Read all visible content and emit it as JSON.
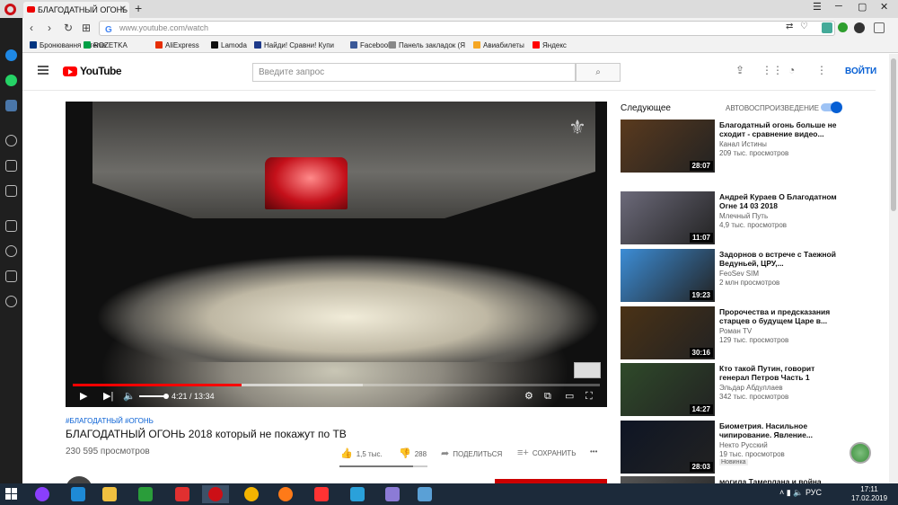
{
  "browser": {
    "tab_title": "БЛАГОДАТНЫЙ ОГОНЬ 2(",
    "url": "www.youtube.com/watch",
    "bookmarks": [
      {
        "label": "Бронювання готелів",
        "color": "#003580"
      },
      {
        "label": "ROZETKA",
        "color": "#00a046"
      },
      {
        "label": "AliExpress",
        "color": "#e62e04"
      },
      {
        "label": "Lamoda",
        "color": "#111111"
      },
      {
        "label": "Найди! Сравни! Купи",
        "color": "#1e3a8a"
      },
      {
        "label": "Facebook",
        "color": "#3b5998"
      },
      {
        "label": "Панель закладок (Я",
        "color": "#888888"
      },
      {
        "label": "Авиабилеты",
        "color": "#f5a623"
      },
      {
        "label": "Яндекс",
        "color": "#ff0000"
      }
    ]
  },
  "youtube": {
    "brand": "YouTube",
    "search_placeholder": "Введите запрос",
    "login_label": "ВОЙТИ"
  },
  "player": {
    "current_time": "4:21",
    "duration": "13:34",
    "time_sep": " / ",
    "played_fraction": 0.321,
    "buffered_fraction": 0.55,
    "volume_fraction": 1.0
  },
  "video": {
    "tags": "#БЛАГОДАТНЫЙ #ОГОНЬ",
    "title": "БЛАГОДАТНЫЙ ОГОНЬ 2018 который не покажут по ТВ",
    "views": "230 595 просмотров",
    "likes": "1,5 тыс.",
    "dislikes": "288",
    "share_label": "ПОДЕЛИТЬСЯ",
    "save_label": "СОХРАНИТЬ",
    "like_ratio": 0.84
  },
  "related": {
    "next_label": "Следующее",
    "autoplay_label": "АВТОВОСПРОИЗВЕДЕНИЕ",
    "items": [
      {
        "title": "Благодатный огонь больше не сходит - сравнение видео...",
        "channel": "Канал Истины",
        "views": "209 тыс. просмотров",
        "duration": "28:07",
        "color": "#5a3a1e"
      },
      {
        "title": "Андрей Кураев О Благодатном Огне 14 03 2018",
        "channel": "Млечный Путь",
        "views": "4,9 тыс. просмотров",
        "duration": "11:07",
        "color": "#6c6a7a"
      },
      {
        "title": "Задорнов о встрече с Таежной Ведуньей, ЦРУ,...",
        "channel": "FeoSev SIM",
        "views": "2 млн просмотров",
        "duration": "19:23",
        "color": "#3c8dd6"
      },
      {
        "title": "Пророчества и предсказания старцев о будущем Царе в...",
        "channel": "Роман TV",
        "views": "129 тыс. просмотров",
        "duration": "30:16",
        "color": "#4a3216"
      },
      {
        "title": "Кто такой Путин, говорит генерал Петров Часть 1",
        "channel": "Эльдар Абдуллаев",
        "views": "342 тыс. просмотров",
        "duration": "14:27",
        "color": "#2f4a2a"
      },
      {
        "title": "Биометрия. Насильное чипирование. Явление...",
        "channel": "Некто Русский",
        "views": "19 тыс. просмотров",
        "duration": "28:03",
        "color": "#0e1524",
        "badge": "Новинка"
      },
      {
        "title": "могила Тамерлана и война",
        "channel": "",
        "views": "",
        "duration": "",
        "color": "#555555"
      }
    ]
  },
  "taskbar": {
    "lang": "РУС",
    "time": "17:11",
    "date": "17.02.2019",
    "apps": [
      {
        "name": "alice-icon",
        "color": "#8a3ffc"
      },
      {
        "name": "ie-icon",
        "color": "#1e8ad6"
      },
      {
        "name": "explorer-icon",
        "color": "#f0c040"
      },
      {
        "name": "store-icon",
        "color": "#2a9d3a"
      },
      {
        "name": "yandex-icon",
        "color": "#e03030"
      },
      {
        "name": "opera-icon",
        "color": "#cc0f16"
      },
      {
        "name": "chrome-icon",
        "color": "#f4b400"
      },
      {
        "name": "firefox-icon",
        "color": "#ff7a18"
      },
      {
        "name": "yandex-browser-icon",
        "color": "#ff3333"
      },
      {
        "name": "telegram-icon",
        "color": "#2aa1da"
      },
      {
        "name": "app-icon",
        "color": "#8c7bd6"
      },
      {
        "name": "display-icon",
        "color": "#5aa0d6"
      }
    ]
  }
}
